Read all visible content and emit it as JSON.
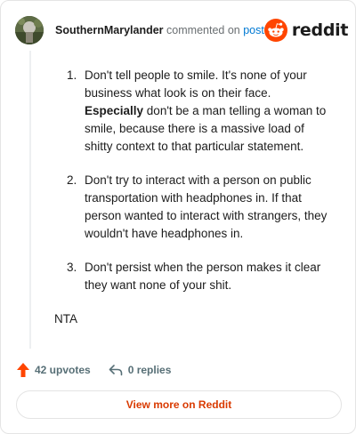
{
  "header": {
    "username": "SouthernMarylander",
    "commented_text": "commented on",
    "post_link": "post",
    "brand": "reddit"
  },
  "comment": {
    "items": [
      {
        "number": "1.",
        "text_before": "Don't tell people to smile. It's none of your business what look is on their face. ",
        "bold": "Especially",
        "text_after": " don't be a man telling a woman to smile, because there is a massive load of shitty context to that particular statement."
      },
      {
        "number": "2.",
        "text_before": "Don't try to interact with a person on public transportation with headphones in. If that person wanted to interact with strangers, they wouldn't have headphones in.",
        "bold": "",
        "text_after": ""
      },
      {
        "number": "3.",
        "text_before": "Don't persist when the person makes it clear they want none of your shit.",
        "bold": "",
        "text_after": ""
      }
    ],
    "closing": "NTA"
  },
  "stats": {
    "upvotes": "42 upvotes",
    "replies": "0 replies",
    "upvote_icon": "upvote-arrow-icon",
    "reply_icon": "reply-arrow-icon"
  },
  "footer": {
    "view_more": "View more on Reddit"
  },
  "colors": {
    "brand_orange": "#ff4500",
    "link_blue": "#0079d3",
    "view_more_text": "#d93a00"
  }
}
